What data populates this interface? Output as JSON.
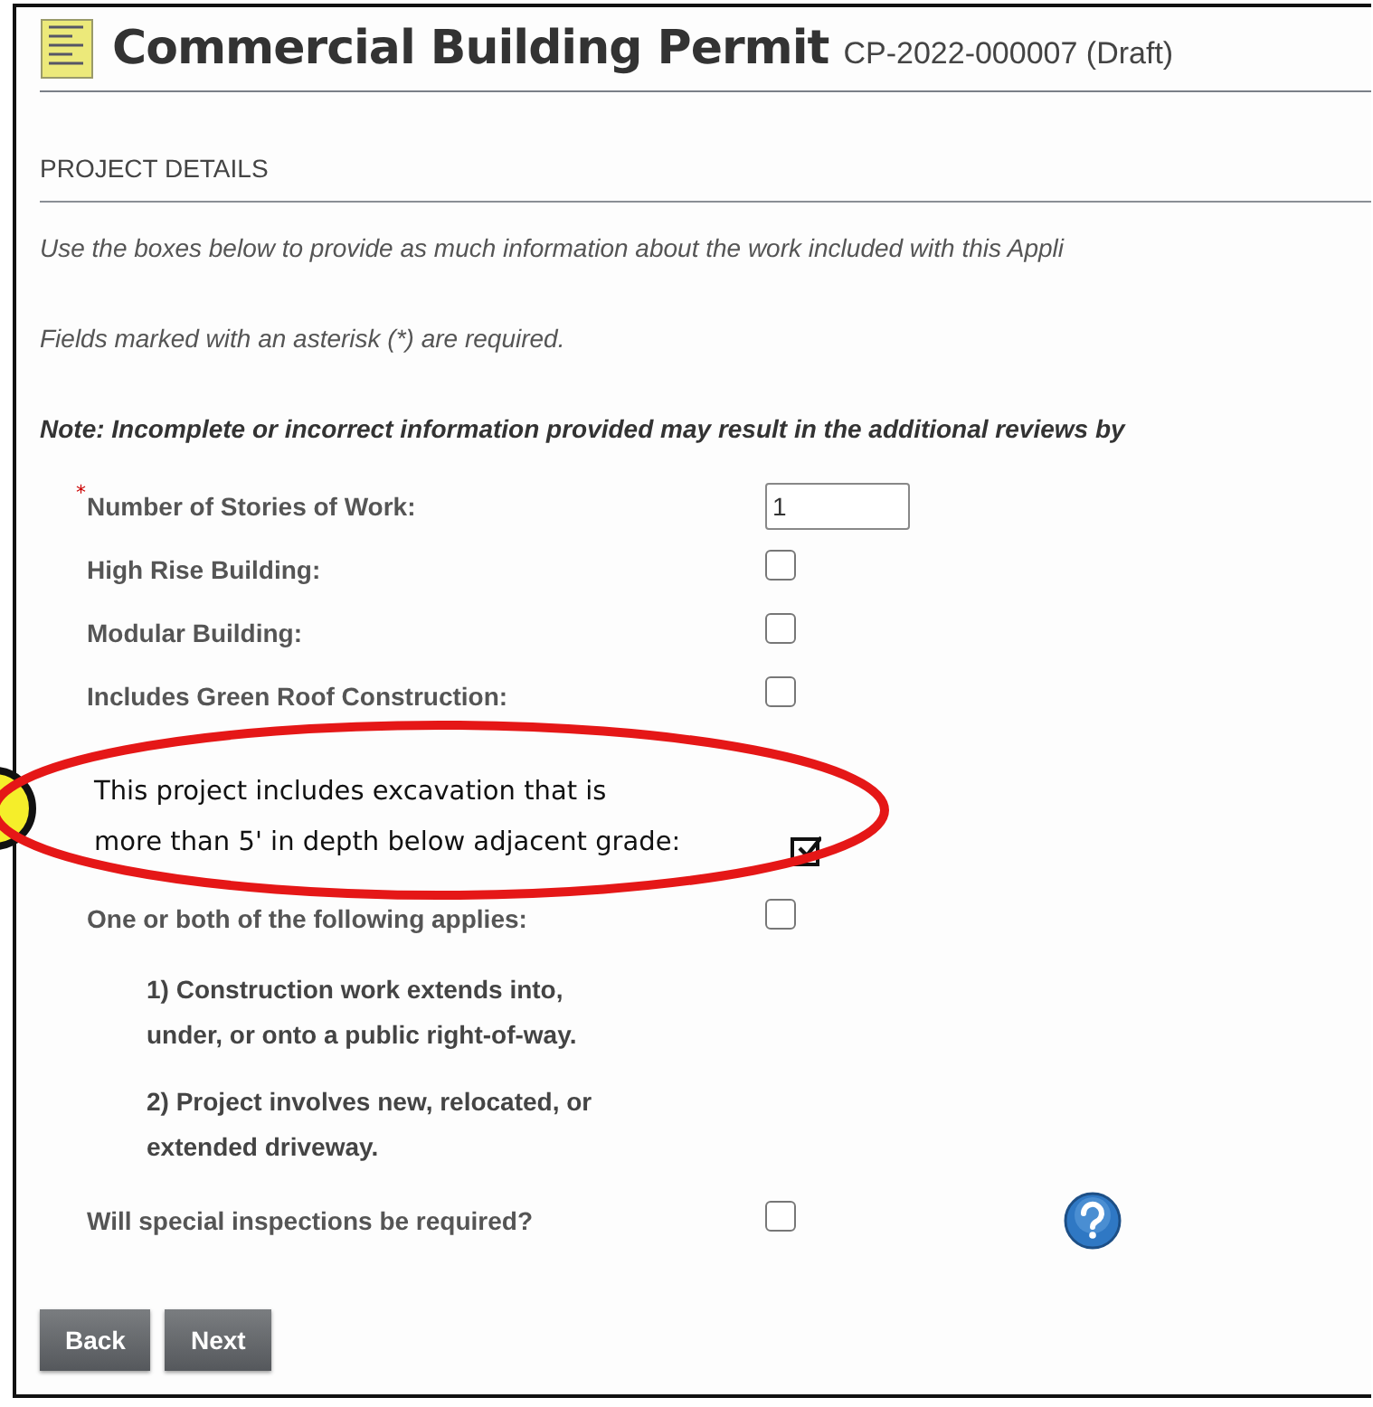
{
  "header": {
    "title": "Commercial Building Permit",
    "record": "CP-2022-000007 (Draft)"
  },
  "section": {
    "title": "PROJECT DETAILS"
  },
  "instructions": [
    {
      "text": "Use the boxes below to provide as much information about the work included with this Appli",
      "bold": false
    },
    {
      "text": "Fields marked with an asterisk (*) are required.",
      "bold": false
    },
    {
      "text": "Note: Incomplete or incorrect information provided may result in the additional reviews by",
      "bold": true
    }
  ],
  "fields": [
    {
      "kind": "input",
      "label": "Number of Stories of Work:",
      "asterisk": "*",
      "value": "1"
    },
    {
      "kind": "checkbox",
      "label": "High Rise Building:",
      "checked": false
    },
    {
      "kind": "checkbox",
      "label": "Modular Building:",
      "checked": false
    },
    {
      "kind": "checkbox",
      "label": "Includes Green Roof Construction:",
      "checked": false
    },
    {
      "kind": "callout",
      "lines": [
        "This project includes excavation that is",
        "more than 5' in depth below adjacent grade:"
      ],
      "checked": true
    },
    {
      "kind": "checkbox",
      "label": "One or both of the following applies:",
      "checked": false,
      "notes": [
        "1) Construction work extends into, under, or onto a public right-of-way.",
        "2) Project involves new, relocated, or extended driveway."
      ]
    },
    {
      "kind": "checkbox",
      "label": "Will special inspections be required?",
      "checked": false,
      "help": true
    }
  ],
  "buttons": [
    "Back",
    "Next"
  ]
}
